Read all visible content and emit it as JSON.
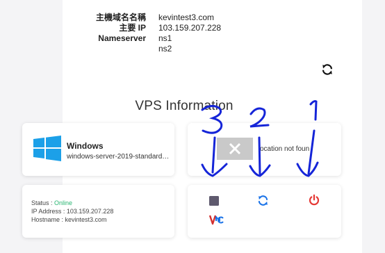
{
  "server_info": {
    "hostname_label": "主機域名名稱",
    "hostname_value": "kevintest3.com",
    "ip_label": "主要 IP",
    "ip_value": "103.159.207.228",
    "nameserver_label": "Nameserver",
    "nameservers": [
      "ns1",
      "ns2"
    ]
  },
  "section_title": "VPS Information",
  "os_card": {
    "name": "Windows",
    "template": "windows-server-2019-standard…"
  },
  "vnc_card": {
    "location_text": "ocation not foun"
  },
  "status_card": {
    "status_label": "Status : ",
    "status_value": "Online",
    "ip_label": "IP Address : ",
    "ip_value": "103.159.207.228",
    "hostname_label": "Hostname : ",
    "hostname_value": "kevintest3.com"
  },
  "actions": {
    "stop_icon": "stop-icon",
    "restart_icon": "refresh-icon",
    "power_icon": "power-icon",
    "vnc_icon": "vnc-icon"
  },
  "annotations": [
    "3",
    "2",
    "1"
  ],
  "colors": {
    "accent_blue": "#1a73e8",
    "online_green": "#2bb673",
    "power_red": "#e53935",
    "stop_gray": "#5f5a6e",
    "annotation_blue": "#1525d8"
  }
}
